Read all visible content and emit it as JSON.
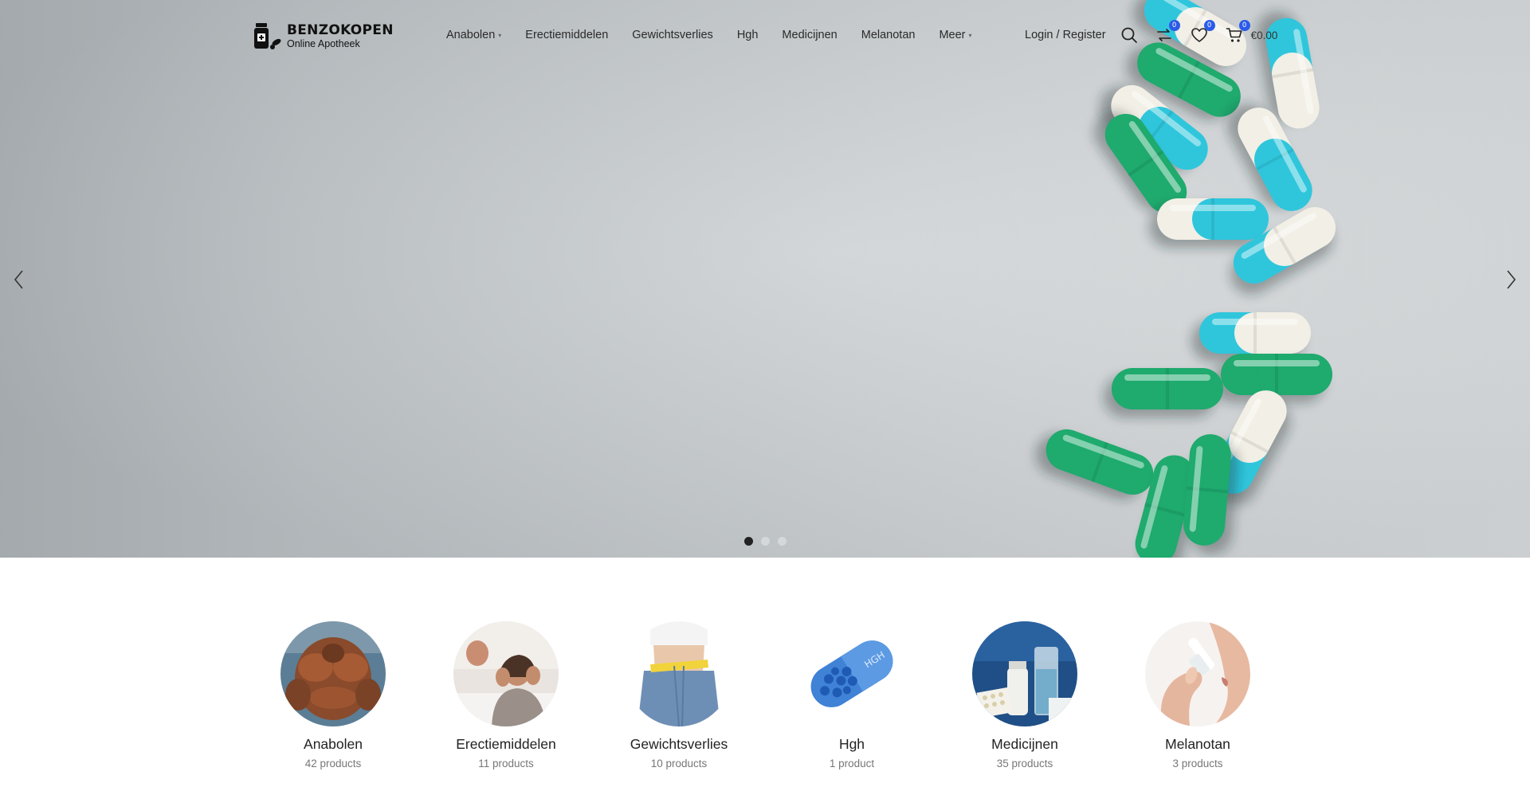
{
  "brand": {
    "name": "BENZOKOPEN",
    "tagline": "Online Apotheek"
  },
  "nav": {
    "items": [
      {
        "label": "Anabolen",
        "has_dropdown": true
      },
      {
        "label": "Erectiemiddelen",
        "has_dropdown": false
      },
      {
        "label": "Gewichtsverlies",
        "has_dropdown": false
      },
      {
        "label": "Hgh",
        "has_dropdown": false
      },
      {
        "label": "Medicijnen",
        "has_dropdown": false
      },
      {
        "label": "Melanotan",
        "has_dropdown": false
      },
      {
        "label": "Meer",
        "has_dropdown": true
      }
    ]
  },
  "header": {
    "login_label": "Login / Register",
    "compare_count": "0",
    "wishlist_count": "0",
    "cart_count": "0",
    "cart_total": "€0.00",
    "icons": [
      "search-icon",
      "compare-icon",
      "heart-icon",
      "cart-icon"
    ]
  },
  "slider": {
    "slides": 3,
    "active_index": 0
  },
  "colors": {
    "accent": "#2b5be8",
    "pill_cyan": "#2fc6dc",
    "pill_green": "#1faa6e",
    "pill_white": "#f2efe6"
  },
  "categories": [
    {
      "name": "Anabolen",
      "count": "42 products"
    },
    {
      "name": "Erectiemiddelen",
      "count": "11 products"
    },
    {
      "name": "Gewichtsverlies",
      "count": "10 products"
    },
    {
      "name": "Hgh",
      "count": "1 product"
    },
    {
      "name": "Medicijnen",
      "count": "35 products"
    },
    {
      "name": "Melanotan",
      "count": "3 products"
    }
  ]
}
